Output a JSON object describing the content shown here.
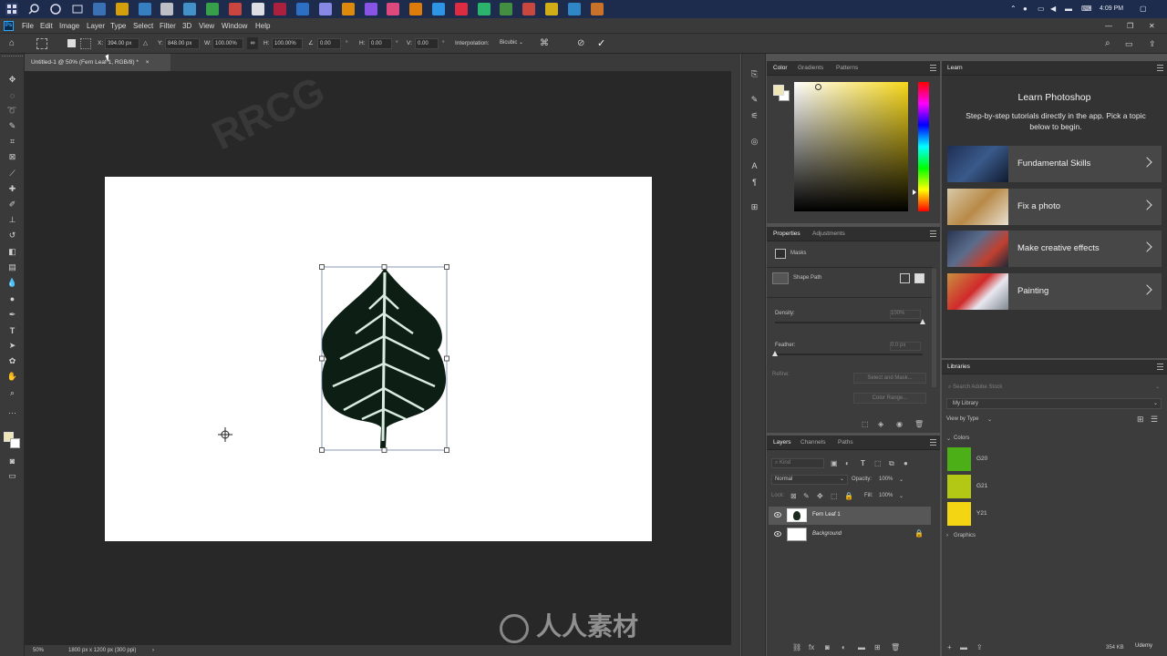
{
  "taskbar": {
    "time": "4:09 PM",
    "app_colors": [
      "#3f7ec7",
      "#f3b400",
      "#3b8ed6",
      "#d9d9d9",
      "#4aa3df",
      "#3cb44a",
      "#e84a3c",
      "#ffffff",
      "#c41e3a",
      "#2f7bd8",
      "#9999ff",
      "#ff9a00",
      "#9b5cff",
      "#ff4f86",
      "#ff8a00",
      "#31a8ff",
      "#ff2b3f",
      "#2ecc71",
      "#4aa03f",
      "#e84c3d",
      "#f1c40f",
      "#3498db",
      "#e67e22"
    ]
  },
  "menubar": {
    "logo": "Ps",
    "items": [
      "File",
      "Edit",
      "Image",
      "Layer",
      "Type",
      "Select",
      "Filter",
      "3D",
      "View",
      "Window",
      "Help"
    ]
  },
  "options": {
    "x_label": "X:",
    "x_value": "394.00 px",
    "y_label": "Y:",
    "y_value": "848.00 px",
    "w_label": "W:",
    "w_value": "100.00%",
    "h_label": "H:",
    "h_value": "100.00%",
    "angle_value": "0.00",
    "angle_unit": "°",
    "hskew_label": "H:",
    "hskew_value": "0.00",
    "hskew_unit": "°",
    "vskew_label": "V:",
    "vskew_value": "0.00",
    "vskew_unit": "°",
    "interp_label": "Interpolation:",
    "interp_value": "Bicubic"
  },
  "document": {
    "tab_title": "Untitled-1 @ 50% (Fern Leaf 1, RGB/8) *",
    "tab_close": "×"
  },
  "status": {
    "zoom": "50%",
    "doc_size": "1800 px x 1200 px (300 ppi)"
  },
  "color_panel": {
    "tabs": [
      "Color",
      "Gradients",
      "Patterns"
    ],
    "fg_color": "#efe6b8",
    "bg_color": "#ffffff",
    "hue_color": "#f7d81a"
  },
  "properties_panel": {
    "tabs": [
      "Properties",
      "Adjustments"
    ],
    "masks_label": "Masks",
    "shape_path_label": "Shape Path",
    "density_label": "Density:",
    "density_value": "100%",
    "density_level": 1.0,
    "feather_label": "Feather:",
    "feather_value": "0.0 px",
    "feather_level": 0.0,
    "refine_label": "Refine:",
    "select_mask_label": "Select and Mask...",
    "color_range_label": "Color Range..."
  },
  "layers_panel": {
    "tabs": [
      "Layers",
      "Channels",
      "Paths"
    ],
    "kind_placeholder": "Kind",
    "blend_mode": "Normal",
    "opacity_label": "Opacity:",
    "opacity_value": "100%",
    "lock_label": "Lock:",
    "fill_label": "Fill:",
    "fill_value": "100%",
    "layers": [
      {
        "name": "Fern Leaf 1",
        "selected": true
      },
      {
        "name": "Background",
        "selected": false
      }
    ]
  },
  "learn_panel": {
    "tab": "Learn",
    "title": "Learn Photoshop",
    "subtitle": "Step-by-step tutorials directly in the app. Pick a topic below to begin.",
    "cards": [
      {
        "label": "Fundamental Skills"
      },
      {
        "label": "Fix a photo"
      },
      {
        "label": "Make creative effects"
      },
      {
        "label": "Painting"
      }
    ]
  },
  "libraries_panel": {
    "tab": "Libraries",
    "search_placeholder": "Search Adobe Stock",
    "library": "My Library",
    "view_by": "View by Type",
    "colors_header": "Colors",
    "colors": [
      {
        "name": "G20",
        "hex": "#4caf17"
      },
      {
        "name": "G21",
        "hex": "#b3c814"
      },
      {
        "name": "Y21",
        "hex": "#f3d514"
      }
    ],
    "graphics_header": "Graphics",
    "footer_size": "354 KB"
  },
  "watermarks": {
    "brand": "RRCG",
    "cn": "人人素材",
    "udemy": "Udemy"
  }
}
